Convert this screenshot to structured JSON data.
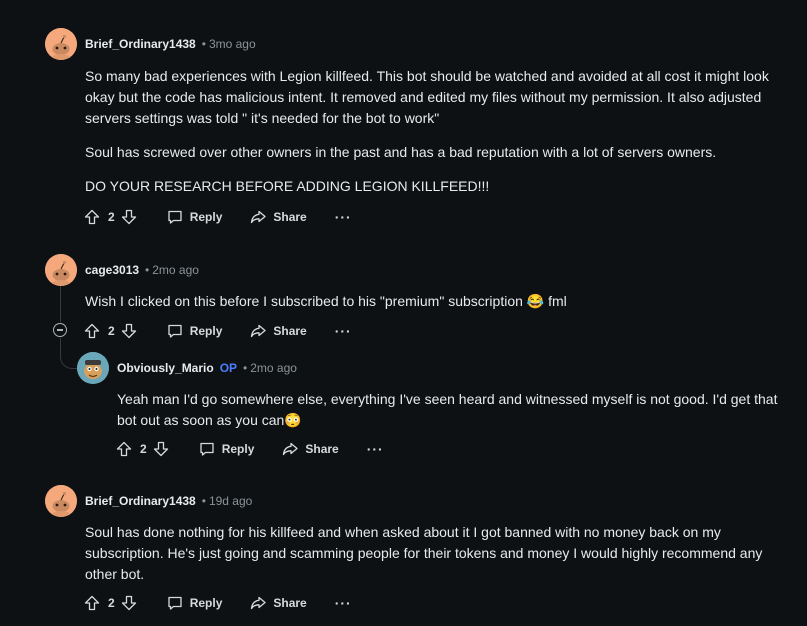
{
  "comments": [
    {
      "username": "Brief_Ordinary1438",
      "time": "3mo ago",
      "paragraphs": [
        "So many bad experiences with Legion killfeed. This bot should be watched and avoided at all cost it might look okay but the code has malicious intent. It removed and edited my files without my permission. It also adjusted servers settings was told \" it's needed for the bot to work\"",
        "Soul has screwed over other owners in the past and has a bad reputation with a lot of servers owners.",
        "DO YOUR RESEARCH BEFORE ADDING LEGION KILLFEED!!!"
      ],
      "votes": "2",
      "reply_label": "Reply",
      "share_label": "Share",
      "more_label": "···"
    },
    {
      "username": "cage3013",
      "time": "2mo ago",
      "text": "Wish I clicked on this before I subscribed to his \"premium\" subscription",
      "emoji": "😂",
      "text_after": "fml",
      "votes": "2",
      "reply_label": "Reply",
      "share_label": "Share",
      "more_label": "···"
    },
    {
      "username": "Obviously_Mario",
      "badge": "OP",
      "time": "2mo ago",
      "text": "Yeah man I'd go somewhere else, everything I've seen heard and witnessed myself is not good. I'd get that bot out as soon as you can",
      "emoji": "😳",
      "votes": "2",
      "reply_label": "Reply",
      "share_label": "Share",
      "more_label": "···"
    },
    {
      "username": "Brief_Ordinary1438",
      "time": "19d ago",
      "text": "Soul has done nothing for his killfeed and when asked about it I got banned with no money back on my subscription. He's just going and scamming people for their tokens and money I would highly recommend any other bot.",
      "votes": "2",
      "reply_label": "Reply",
      "share_label": "Share",
      "more_label": "···"
    }
  ],
  "separator": "•",
  "colors": {
    "background": "#0e1113",
    "text": "#e8ebed",
    "muted": "#8b9397",
    "op_badge": "#4a7eff",
    "avatar": "#f4a87c"
  },
  "icons": {
    "upvote": "upvote-icon",
    "downvote": "downvote-icon",
    "reply": "reply-icon",
    "share": "share-icon",
    "collapse": "collapse-icon"
  }
}
